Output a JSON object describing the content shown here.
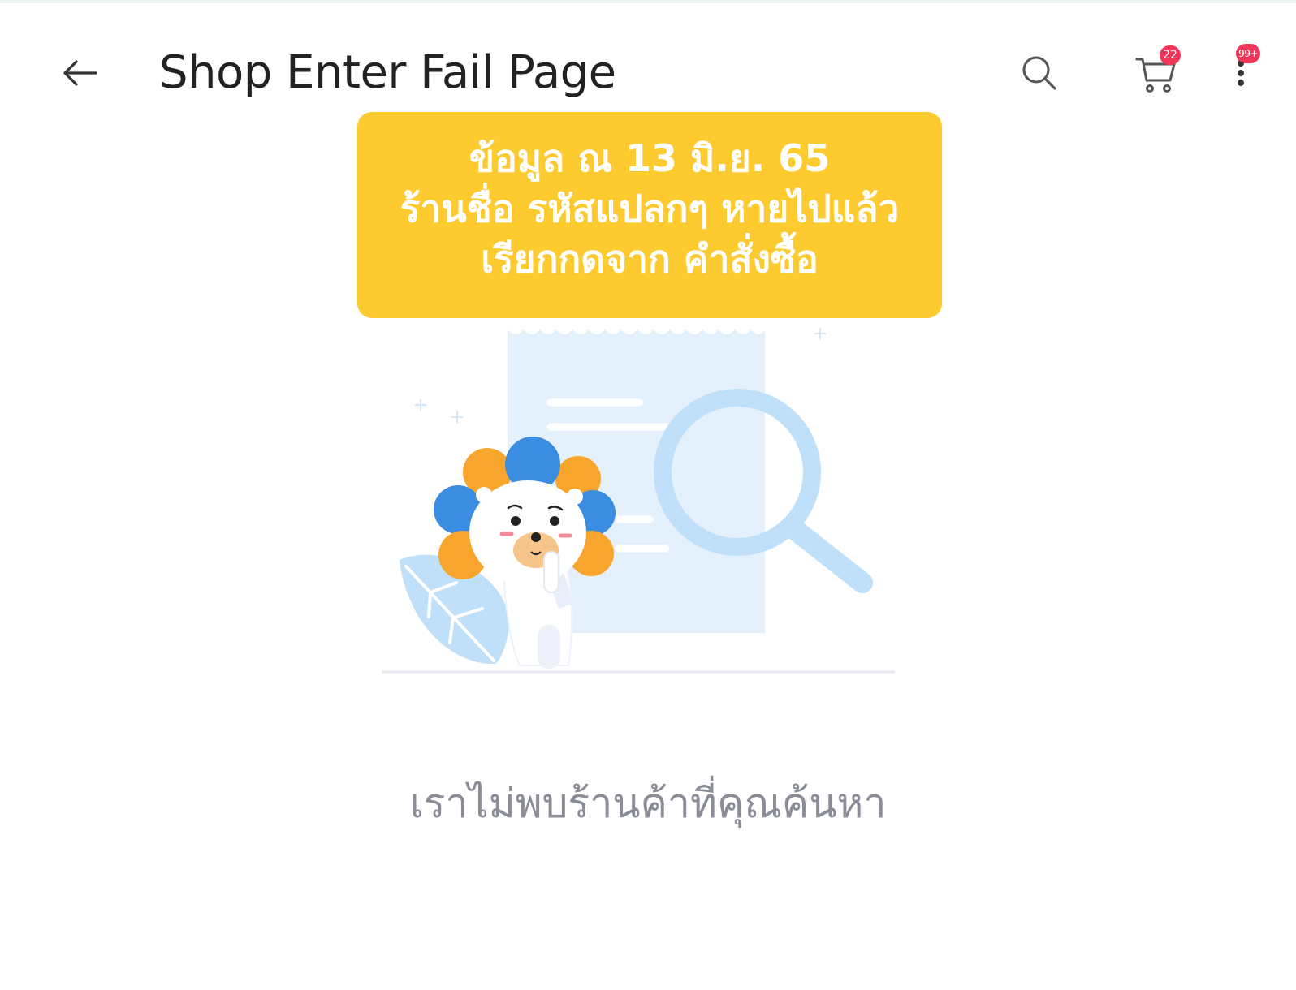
{
  "header": {
    "title": "Shop Enter Fail Page",
    "back_icon": "arrow-left-icon",
    "search_icon": "search-icon",
    "cart_icon": "cart-icon",
    "cart_badge": "22",
    "more_icon": "more-vertical-icon",
    "more_badge": "99+"
  },
  "notice": {
    "lines": [
      "ข้อมูล ณ 13 มิ.ย. 65",
      "ร้านชื่อ รหัสแปลกๆ  หายไปแล้ว",
      "เรียกกดจาก คำสั่งซื้อ"
    ],
    "background": "#fdca30"
  },
  "illustration": {
    "icon": "not-found-mascot-illustration"
  },
  "message": "เราไม่พบร้านค้าที่คุณค้นหา",
  "colors": {
    "badge": "#f0375a",
    "title": "#222222",
    "message": "#8a8c98"
  }
}
